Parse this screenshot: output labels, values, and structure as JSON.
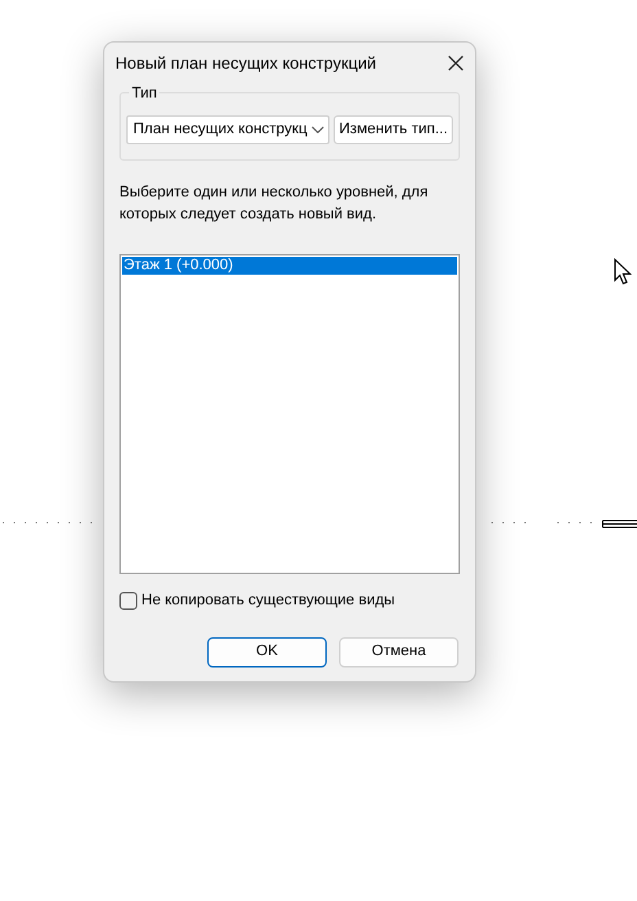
{
  "dialog": {
    "title": "Новый план несущих конструкций"
  },
  "type_group": {
    "legend": "Тип",
    "dropdown_value": "План несущих конструкц",
    "change_button": "Изменить тип..."
  },
  "instruction": "Выберите один или несколько уровней, для которых следует создать новый вид.",
  "levels": [
    {
      "label": "Этаж 1 (+0.000)",
      "selected": true
    }
  ],
  "no_copy": {
    "label": "Не копировать существующие виды",
    "checked": false
  },
  "buttons": [
    {
      "label": "OK",
      "kind": "primary"
    },
    {
      "label": "Отмена",
      "kind": "secondary"
    }
  ]
}
